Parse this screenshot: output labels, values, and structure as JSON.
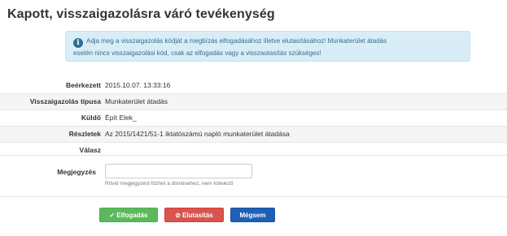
{
  "page": {
    "title": "Kapott, visszaigazolásra váró tevékenység"
  },
  "info": {
    "icon": "info-icon",
    "icon_glyph": "i",
    "line1": "Adja meg a visszaigazolás kódját a megbízás elfogadásához illetve elutasításához! Munkaterület átadás",
    "line2": "esetén nincs visszaigazolási kód, csak az elfogadás vagy a visszautasítás szükséges!"
  },
  "details": {
    "rows": [
      {
        "label": "Beérkezett",
        "value": "2015.10.07. 13:33:16"
      },
      {
        "label": "Visszaigazolás típusa",
        "value": "Munkaterület átadás"
      },
      {
        "label": "Küldő",
        "value": "Épít Elek_"
      },
      {
        "label": "Részletek",
        "value": "Az 2015/1421/51-1 iktatószámú napló munkaterület átadása"
      },
      {
        "label": "Válasz",
        "value": ""
      }
    ]
  },
  "note": {
    "label": "Megjegyzés",
    "value": "",
    "placeholder": "",
    "help": "Rövid megjegyzést fűzhet a döntéséhez, nem kötelező"
  },
  "buttons": {
    "accept": {
      "icon": "check-icon",
      "glyph": "✓",
      "label": "Elfogadás"
    },
    "reject": {
      "icon": "ban-icon",
      "glyph": "⊘",
      "label": "Elutasítás"
    },
    "cancel": {
      "label": "Mégsem"
    }
  },
  "colors": {
    "info_bg": "#d9edf7",
    "info_text": "#31708f",
    "accept": "#5cb85c",
    "reject": "#d9534f",
    "cancel": "#1f5fb4"
  }
}
